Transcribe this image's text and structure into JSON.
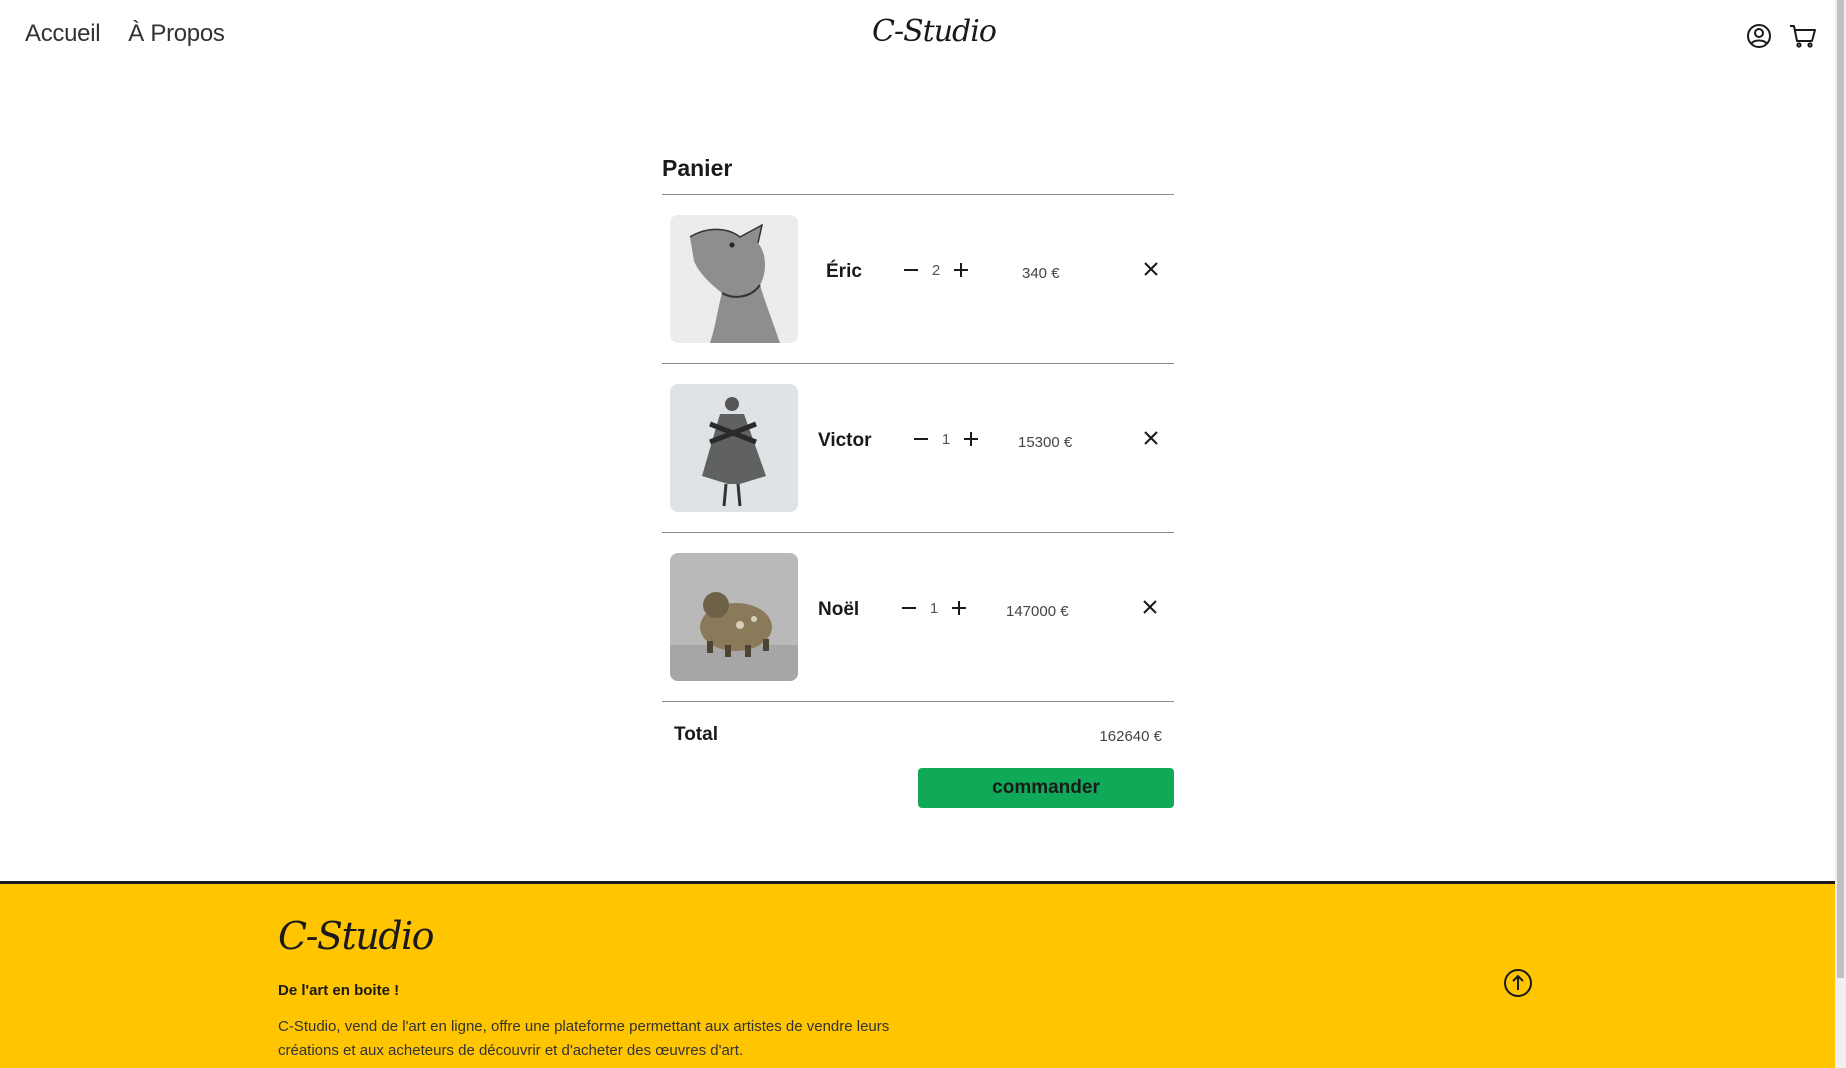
{
  "header": {
    "nav": [
      "Accueil",
      "À Propos"
    ],
    "brand": "C-Studio",
    "icons": [
      "account-icon",
      "cart-icon"
    ]
  },
  "cart": {
    "title": "Panier",
    "items": [
      {
        "name": "Éric",
        "quantity": "2",
        "price": "340 €",
        "image": "dog-sketch-artwork"
      },
      {
        "name": "Victor",
        "quantity": "1",
        "price": "15300 €",
        "image": "figure-collage-artwork"
      },
      {
        "name": "Noël",
        "quantity": "1",
        "price": "147000 €",
        "image": "bronze-sculpture-artwork"
      }
    ],
    "total_label": "Total",
    "total_value": "162640 €",
    "order_label": "commander"
  },
  "footer": {
    "brand": "C-Studio",
    "tagline": "De l'art en boite !",
    "about": "C-Studio, vend de l'art en ligne, offre une plateforme permettant aux artistes de vendre leurs créations et aux acheteurs de découvrir et d'acheter des œuvres d'art."
  },
  "colors": {
    "accent_green": "#0fa958",
    "footer_yellow": "#fec500",
    "text": "#1a1a1a"
  }
}
